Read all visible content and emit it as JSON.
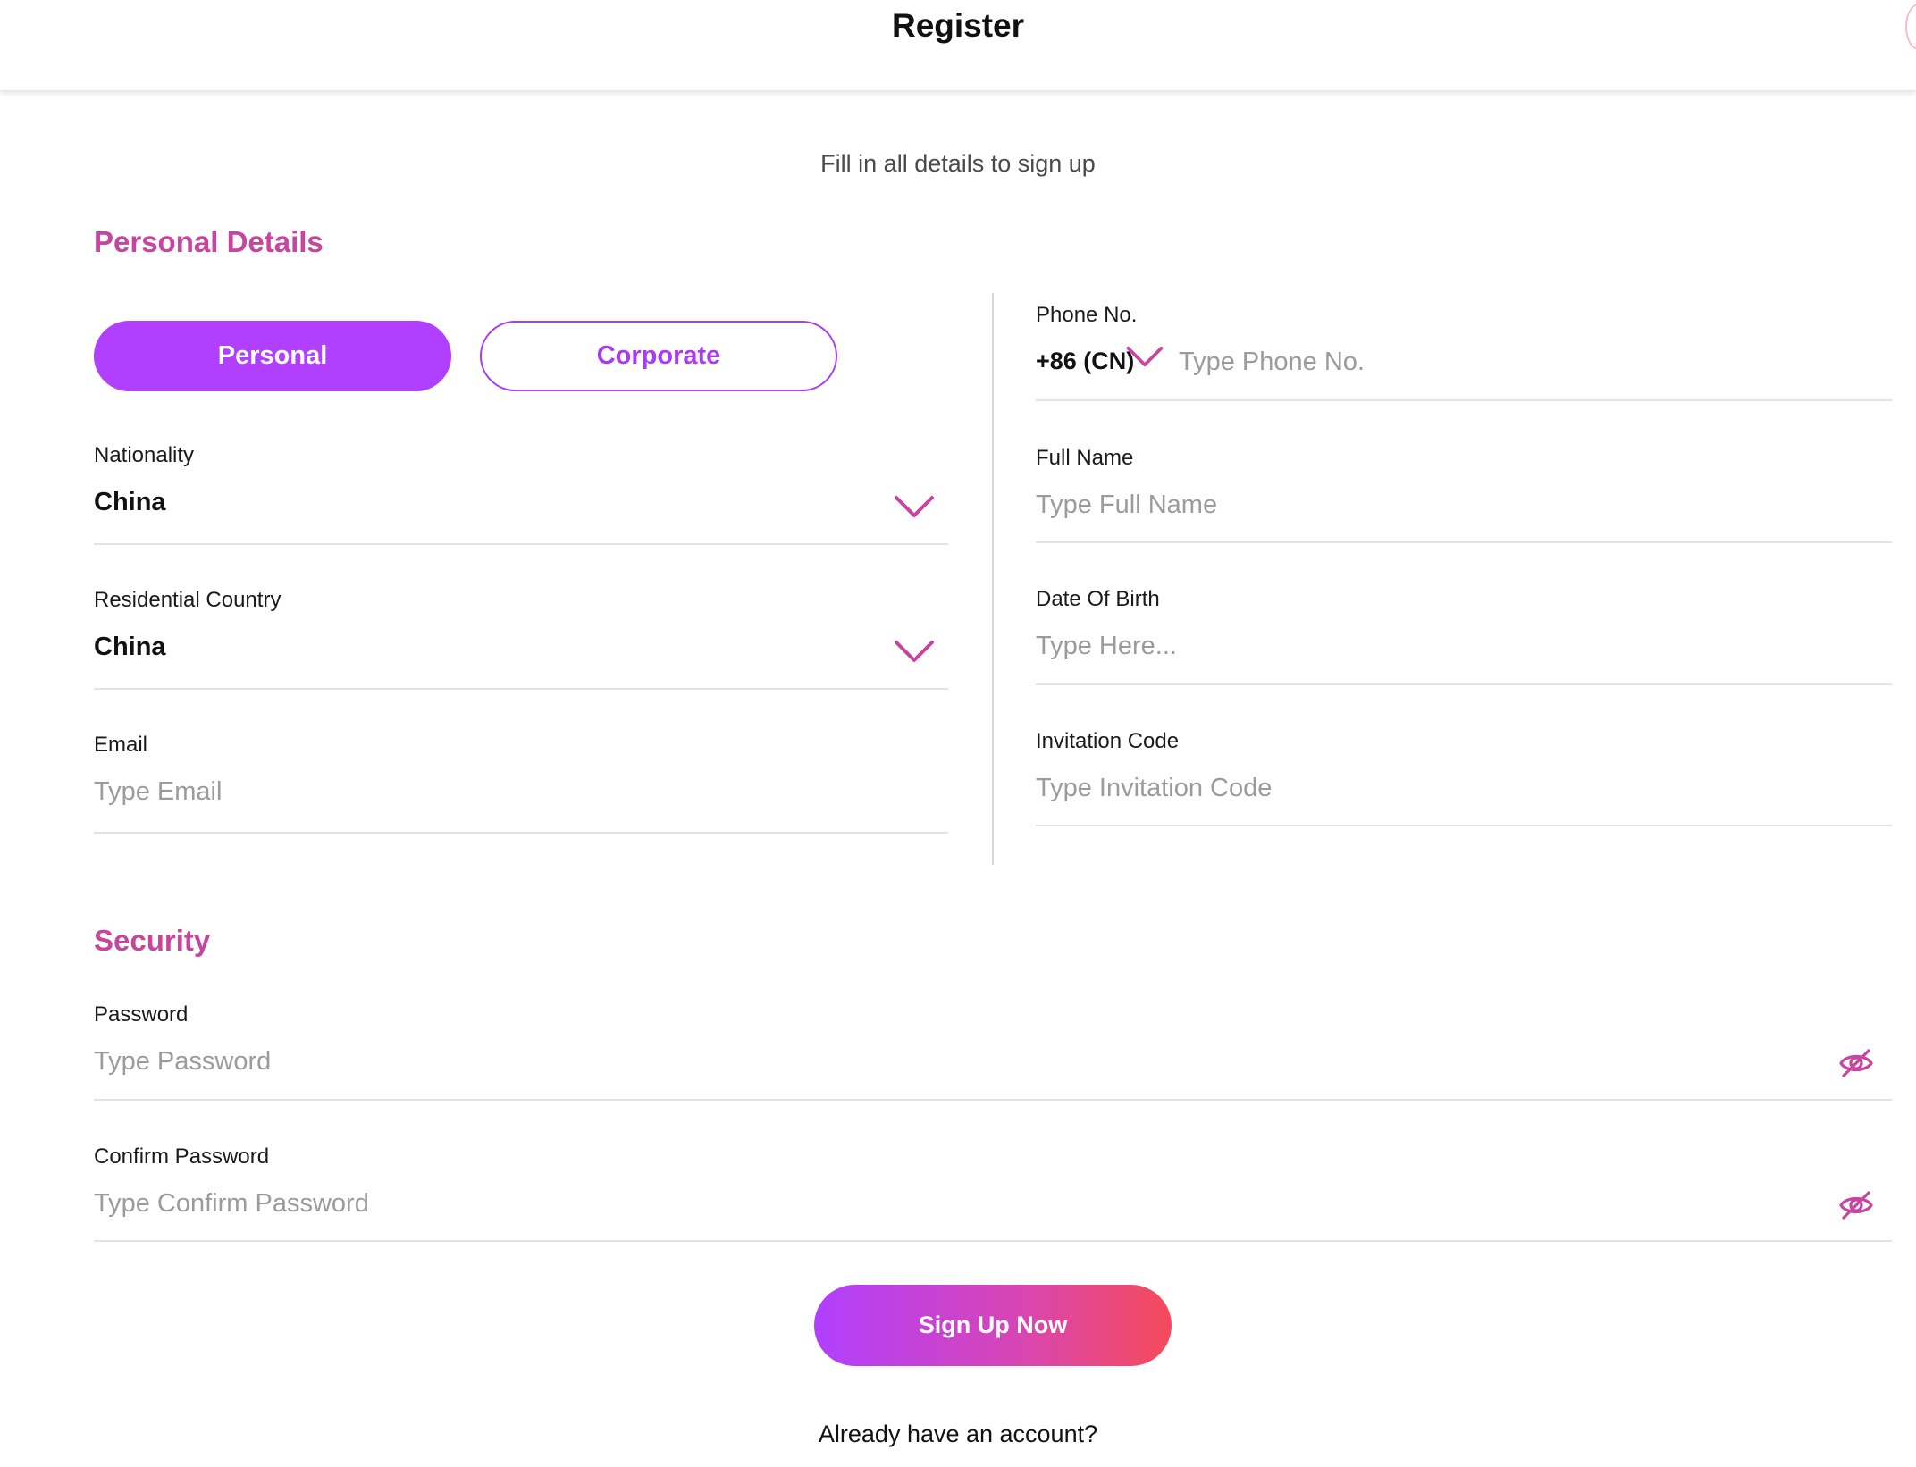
{
  "header": {
    "title": "Register"
  },
  "subtitle": "Fill in all details to sign up",
  "personal_section": {
    "title": "Personal Details",
    "account_types": {
      "active": "Personal",
      "inactive": "Corporate"
    },
    "nationality": {
      "label": "Nationality",
      "value": "China"
    },
    "residential_country": {
      "label": "Residential Country",
      "value": "China"
    },
    "email": {
      "label": "Email",
      "placeholder": "Type Email"
    },
    "phone": {
      "label": "Phone No.",
      "country_code": "+86 (CN)",
      "placeholder": "Type Phone No."
    },
    "full_name": {
      "label": "Full Name",
      "placeholder": "Type Full Name"
    },
    "date_of_birth": {
      "label": "Date Of Birth",
      "placeholder": "Type Here..."
    },
    "invitation_code": {
      "label": "Invitation Code",
      "placeholder": "Type Invitation Code"
    }
  },
  "security_section": {
    "title": "Security",
    "password": {
      "label": "Password",
      "placeholder": "Type Password"
    },
    "confirm_password": {
      "label": "Confirm Password",
      "placeholder": "Type Confirm Password"
    }
  },
  "actions": {
    "signup_label": "Sign Up Now",
    "login_prompt": "Already have an account?"
  },
  "colors": {
    "accent_magenta": "#c7449f",
    "primary_purple": "#b03fff",
    "gradient_end": "#f54a5a",
    "placeholder_gray": "#9b9b9b",
    "divider_gray": "#e3e3e3"
  },
  "icons": {
    "dropdown": "chevron-down-icon",
    "password_visibility": "eye-off-icon"
  }
}
